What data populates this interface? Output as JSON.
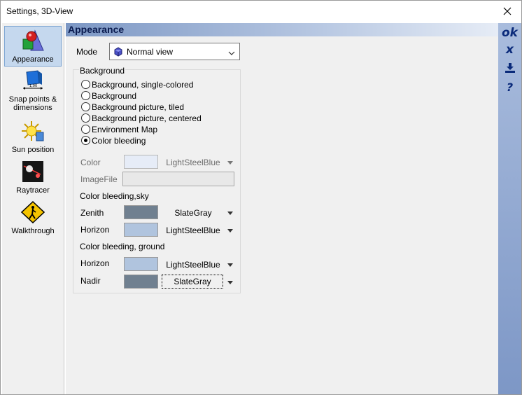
{
  "window": {
    "title": "Settings, 3D-View"
  },
  "sidebar": {
    "items": [
      {
        "label": "Appearance",
        "icon": "shapes-icon"
      },
      {
        "label": "Snap points & dimensions",
        "icon": "cube-dimension-icon"
      },
      {
        "label": "Sun position",
        "icon": "sun-icon"
      },
      {
        "label": "Raytracer",
        "icon": "raytracer-icon"
      },
      {
        "label": "Walkthrough",
        "icon": "walkthrough-icon"
      }
    ]
  },
  "main": {
    "header": "Appearance",
    "mode_label": "Mode",
    "mode_value": "Normal view",
    "background_group_label": "Background",
    "radios": [
      {
        "label": "Background, single-colored",
        "checked": false
      },
      {
        "label": "Background",
        "checked": false
      },
      {
        "label": "Background picture, tiled",
        "checked": false
      },
      {
        "label": "Background picture, centered",
        "checked": false
      },
      {
        "label": "Environment Map",
        "checked": false
      },
      {
        "label": "Color bleeding",
        "checked": true
      }
    ],
    "color_label": "Color",
    "color_value": "LightSteelBlue",
    "imagefile_label": "ImageFile",
    "sky_section": "Color bleeding,sky",
    "zenith_label": "Zenith",
    "zenith_value": "SlateGray",
    "sky_horizon_label": "Horizon",
    "sky_horizon_value": "LightSteelBlue",
    "ground_section": "Color bleeding, ground",
    "ground_horizon_label": "Horizon",
    "ground_horizon_value": "LightSteelBlue",
    "nadir_label": "Nadir",
    "nadir_value": "SlateGray"
  },
  "right_bar": {
    "ok": "ok",
    "cancel": "x"
  },
  "colors": {
    "lightsteelblue": "#b0c4de",
    "slategray": "#708090",
    "disabled_color": "#e6ecf7"
  }
}
